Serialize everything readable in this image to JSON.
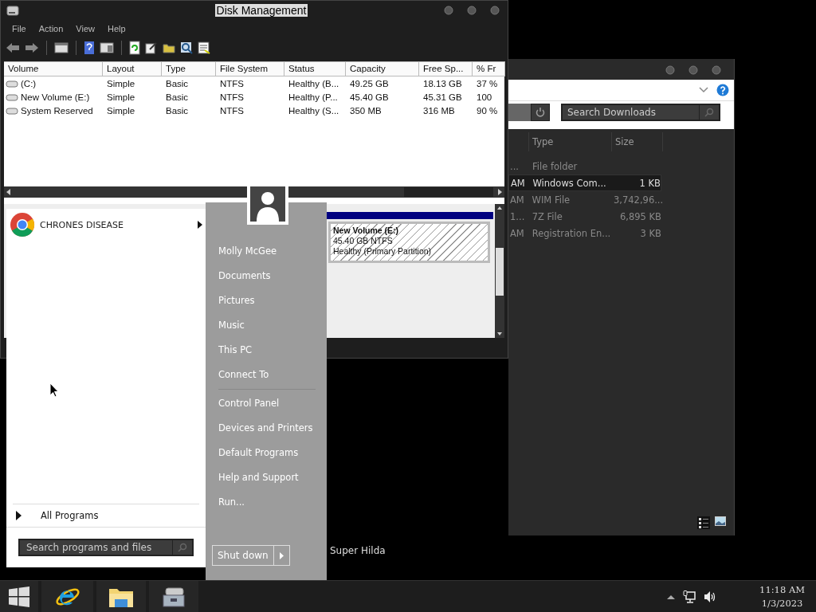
{
  "disk_management": {
    "title": "Disk Management",
    "menu": [
      "File",
      "Action",
      "View",
      "Help"
    ],
    "columns": [
      "Volume",
      "Layout",
      "Type",
      "File System",
      "Status",
      "Capacity",
      "Free Sp...",
      "% Fr"
    ],
    "rows": [
      {
        "cells": [
          "(C:)",
          "Simple",
          "Basic",
          "NTFS",
          "Healthy (B...",
          "49.25 GB",
          "18.13 GB",
          "37 %"
        ]
      },
      {
        "cells": [
          "New Volume (E:)",
          "Simple",
          "Basic",
          "NTFS",
          "Healthy (P...",
          "45.40 GB",
          "45.31 GB",
          "100"
        ]
      },
      {
        "cells": [
          "System Reserved",
          "Simple",
          "Basic",
          "NTFS",
          "Healthy (S...",
          "350 MB",
          "316 MB",
          "90 %"
        ]
      }
    ],
    "partition": {
      "name": "New Volume  (E:)",
      "size": "45.40 GB NTFS",
      "status": "Healthy (Primary Partition)"
    }
  },
  "downloads": {
    "search": {
      "placeholder": "Search Downloads"
    },
    "columns": [
      "Type",
      "Size"
    ],
    "rows": [
      {
        "column_1": "...",
        "type": "File folder",
        "selected": false
      },
      {
        "column_1": "AM",
        "type": "Windows Com...",
        "size": "1 KB",
        "selected": true
      },
      {
        "column_1": "AM",
        "type": "WIM File",
        "size": "3,742,96...",
        "selected": false
      },
      {
        "column_1": "1...",
        "type": "7Z File",
        "size": "6,895 KB",
        "selected": false
      },
      {
        "column_1": "AM",
        "type": "Registration En...",
        "size": "3 KB",
        "selected": false
      }
    ]
  },
  "start_menu": {
    "programs": [
      {
        "label": "CHRONES DISEASE",
        "has_submenu": true
      }
    ],
    "all_programs": "All Programs",
    "search": {
      "placeholder": "Search programs and files"
    },
    "user": "Molly McGee",
    "link_groups": [
      [
        "Documents",
        "Pictures",
        "Music",
        "This PC",
        "Connect To"
      ],
      [
        "Control Panel",
        "Devices and Printers",
        "Default Programs",
        "Help and Support",
        "Run..."
      ]
    ],
    "shutdown": "Shut down"
  },
  "desktop": {
    "label": "Super Hilda"
  },
  "taskbar": {
    "time": "11:18 AM",
    "date": "1/3/2023"
  }
}
